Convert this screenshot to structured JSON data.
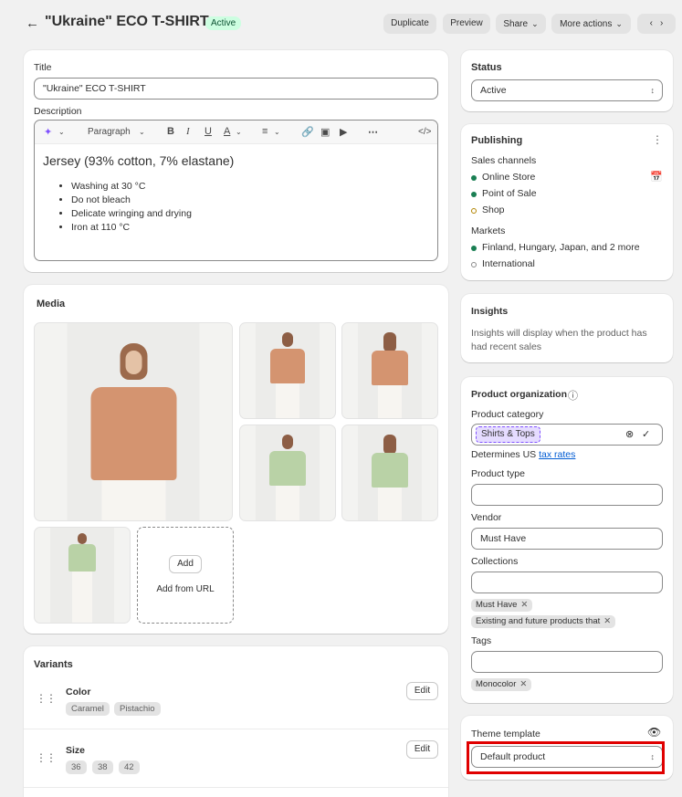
{
  "header": {
    "back_icon": "arrow-left-icon",
    "title": "\"Ukraine\" ECO T-SHIRT",
    "status_badge": "Active",
    "buttons": {
      "duplicate": "Duplicate",
      "preview": "Preview",
      "share": "Share",
      "more_actions": "More actions"
    }
  },
  "main": {
    "title_label": "Title",
    "title_value": "\"Ukraine\" ECO T-SHIRT",
    "description_label": "Description",
    "editor": {
      "paragraph_select": "Paragraph",
      "heading_text": "Jersey (93% cotton, 7% elastane)",
      "bullets": [
        "Washing at 30 °C",
        "Do not bleach",
        "Delicate wringing and drying",
        "Iron at 110 °C"
      ]
    },
    "media": {
      "heading": "Media",
      "add_button": "Add",
      "add_from_url": "Add from URL"
    },
    "variants": {
      "heading": "Variants",
      "options": [
        {
          "name": "Color",
          "values": [
            "Caramel",
            "Pistachio"
          ],
          "edit": "Edit"
        },
        {
          "name": "Size",
          "values": [
            "36",
            "38",
            "42"
          ],
          "edit": "Edit"
        }
      ]
    }
  },
  "sidebar": {
    "status": {
      "heading": "Status",
      "value": "Active"
    },
    "publishing": {
      "heading": "Publishing",
      "sales_channels_label": "Sales channels",
      "channels": [
        "Online Store",
        "Point of Sale",
        "Shop"
      ],
      "markets_label": "Markets",
      "markets": [
        "Finland, Hungary, Japan, and 2 more",
        "International"
      ]
    },
    "insights": {
      "heading": "Insights",
      "text": "Insights will display when the product has had recent sales"
    },
    "organization": {
      "heading": "Product organization",
      "category_label": "Product category",
      "category_chip": "Shirts & Tops",
      "determines_text": "Determines US",
      "tax_link": "tax rates",
      "product_type_label": "Product type",
      "product_type_value": "",
      "vendor_label": "Vendor",
      "vendor_value": "Must Have",
      "collections_label": "Collections",
      "collections": [
        "Must Have",
        "Existing and future products that"
      ],
      "tags_label": "Tags",
      "tags": [
        "Monocolor"
      ]
    },
    "theme": {
      "label": "Theme template",
      "value": "Default product"
    }
  },
  "colors": {
    "accent": "#005bd3",
    "active_badge_bg": "#cdfee1",
    "published_dot": "#1a7f53",
    "highlight": "#e00000"
  }
}
